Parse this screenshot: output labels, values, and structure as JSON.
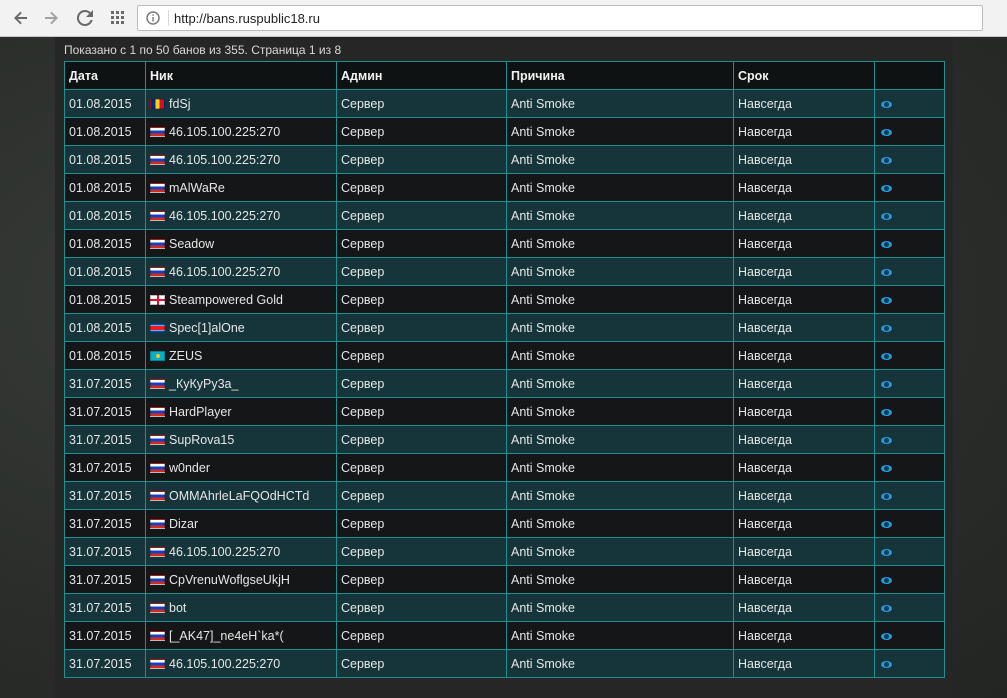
{
  "browser": {
    "url": "http://bans.ruspublic18.ru",
    "icons": [
      "back-icon",
      "forward-icon",
      "reload-icon",
      "apps-icon",
      "page-info-icon"
    ]
  },
  "summary": "Показано с 1 по 50 банов из 355. Страница 1 из 8",
  "table": {
    "headers": [
      "Дата",
      "Ник",
      "Админ",
      "Причина",
      "Срок",
      ""
    ],
    "rows": [
      {
        "date": "01.08.2015",
        "flag": "ro",
        "nick": "fdSj",
        "admin": "Сервер",
        "reason": "Anti Smoke",
        "term": "Навсегда"
      },
      {
        "date": "01.08.2015",
        "flag": "ru",
        "nick": "46.105.100.225:270",
        "admin": "Сервер",
        "reason": "Anti Smoke",
        "term": "Навсегда"
      },
      {
        "date": "01.08.2015",
        "flag": "ru",
        "nick": "46.105.100.225:270",
        "admin": "Сервер",
        "reason": "Anti Smoke",
        "term": "Навсегда"
      },
      {
        "date": "01.08.2015",
        "flag": "ru",
        "nick": "mAlWaRe",
        "admin": "Сервер",
        "reason": "Anti Smoke",
        "term": "Навсегда"
      },
      {
        "date": "01.08.2015",
        "flag": "ru",
        "nick": "46.105.100.225:270",
        "admin": "Сервер",
        "reason": "Anti Smoke",
        "term": "Навсегда"
      },
      {
        "date": "01.08.2015",
        "flag": "ru",
        "nick": "Seadow",
        "admin": "Сервер",
        "reason": "Anti Smoke",
        "term": "Навсегда"
      },
      {
        "date": "01.08.2015",
        "flag": "ru",
        "nick": "46.105.100.225:270",
        "admin": "Сервер",
        "reason": "Anti Smoke",
        "term": "Навсегда"
      },
      {
        "date": "01.08.2015",
        "flag": "ge",
        "nick": "Steampowered Gold",
        "admin": "Сервер",
        "reason": "Anti Smoke",
        "term": "Навсегда"
      },
      {
        "date": "01.08.2015",
        "flag": "kp",
        "nick": "Spec[1]alOne",
        "admin": "Сервер",
        "reason": "Anti Smoke",
        "term": "Навсегда"
      },
      {
        "date": "01.08.2015",
        "flag": "kz",
        "nick": "ZEUS",
        "admin": "Сервер",
        "reason": "Anti Smoke",
        "term": "Навсегда"
      },
      {
        "date": "31.07.2015",
        "flag": "ru",
        "nick": "_КуКуРу3а_",
        "admin": "Сервер",
        "reason": "Anti Smoke",
        "term": "Навсегда"
      },
      {
        "date": "31.07.2015",
        "flag": "ru",
        "nick": "HardPlayer",
        "admin": "Сервер",
        "reason": "Anti Smoke",
        "term": "Навсегда"
      },
      {
        "date": "31.07.2015",
        "flag": "ru",
        "nick": "SupRova15",
        "admin": "Сервер",
        "reason": "Anti Smoke",
        "term": "Навсегда"
      },
      {
        "date": "31.07.2015",
        "flag": "ru",
        "nick": "w0nder",
        "admin": "Сервер",
        "reason": "Anti Smoke",
        "term": "Навсегда"
      },
      {
        "date": "31.07.2015",
        "flag": "ru",
        "nick": "OMMAhrleLaFQOdHCTd",
        "admin": "Сервер",
        "reason": "Anti Smoke",
        "term": "Навсегда"
      },
      {
        "date": "31.07.2015",
        "flag": "ru",
        "nick": "Dizar",
        "admin": "Сервер",
        "reason": "Anti Smoke",
        "term": "Навсегда"
      },
      {
        "date": "31.07.2015",
        "flag": "ru",
        "nick": "46.105.100.225:270",
        "admin": "Сервер",
        "reason": "Anti Smoke",
        "term": "Навсегда"
      },
      {
        "date": "31.07.2015",
        "flag": "ru",
        "nick": "CpVrenuWoflgseUkjH",
        "admin": "Сервер",
        "reason": "Anti Smoke",
        "term": "Навсегда"
      },
      {
        "date": "31.07.2015",
        "flag": "ru",
        "nick": "bot",
        "admin": "Сервер",
        "reason": "Anti Smoke",
        "term": "Навсегда"
      },
      {
        "date": "31.07.2015",
        "flag": "ru",
        "nick": "[_AK47]_ne4eH`ka*(",
        "admin": "Сервер",
        "reason": "Anti Smoke",
        "term": "Навсегда"
      },
      {
        "date": "31.07.2015",
        "flag": "ru",
        "nick": "46.105.100.225:270",
        "admin": "Сервер",
        "reason": "Anti Smoke",
        "term": "Навсегда"
      }
    ]
  }
}
